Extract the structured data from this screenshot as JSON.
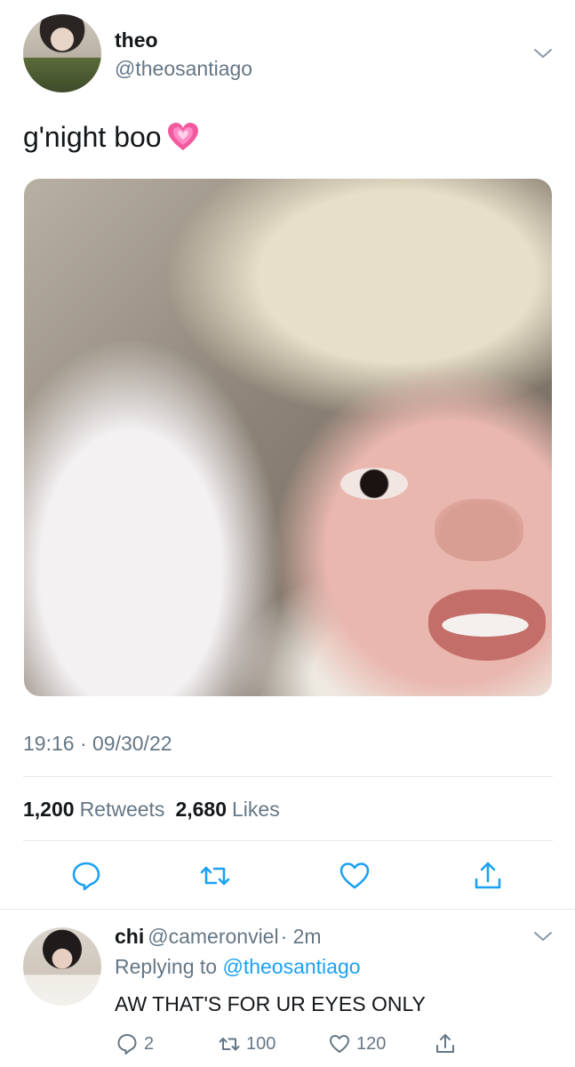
{
  "tweet": {
    "author_name": "theo",
    "author_handle": "@theosantiago",
    "text": "g'night boo",
    "timestamp": "19:16 · 09/30/22",
    "retweets_count": "1,200",
    "retweets_label": "Retweets",
    "likes_count": "2,680",
    "likes_label": "Likes"
  },
  "reply": {
    "author_name": "chi",
    "author_handle": "@cameronviel",
    "time": "· 2m",
    "replying_prefix": "Replying to",
    "replying_to": "@theosantiago",
    "text": "AW THAT'S FOR UR EYES ONLY",
    "reply_count": "2",
    "retweet_count": "100",
    "like_count": "120"
  },
  "colors": {
    "text": "#14171a",
    "secondary": "#657786",
    "accent": "#1da1f2",
    "divider": "#e1e8ed"
  },
  "icons": {
    "more": "chevron-down-icon",
    "emoji": "sparkling-heart-icon",
    "reply": "reply-icon",
    "retweet": "retweet-icon",
    "like": "heart-icon",
    "share": "share-icon"
  }
}
